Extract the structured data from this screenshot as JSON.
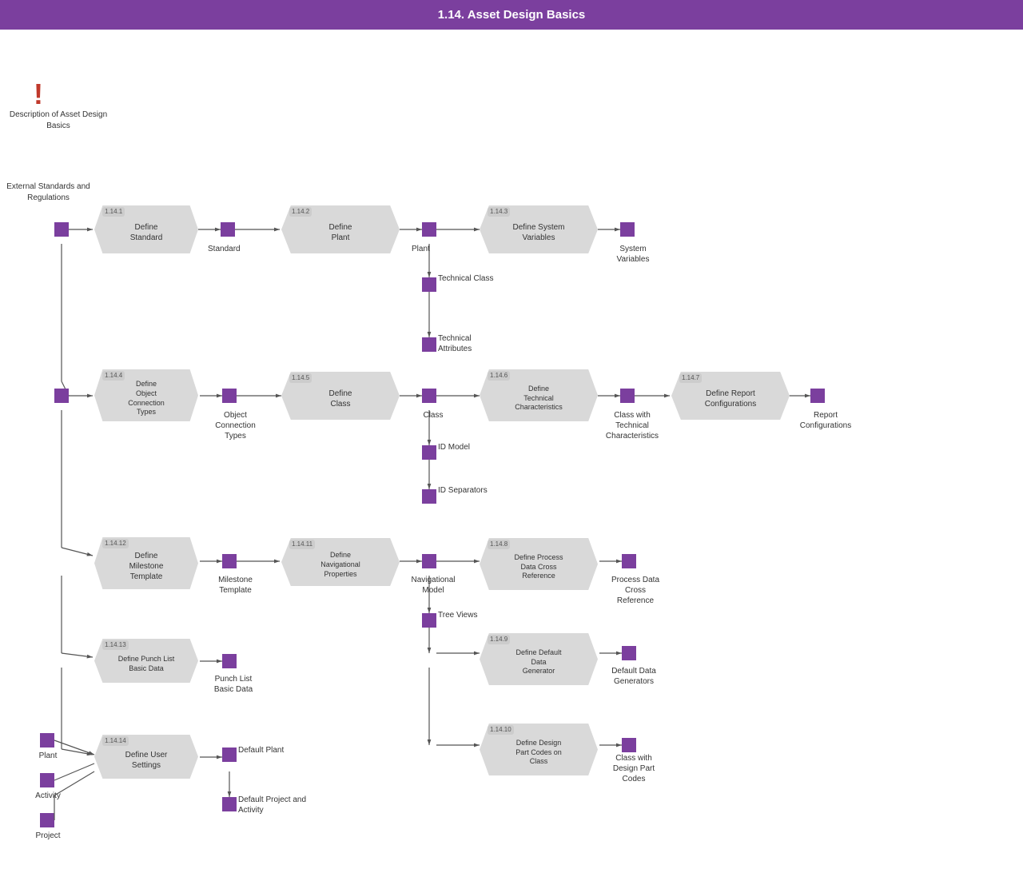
{
  "header": {
    "title": "1.14. Asset Design Basics"
  },
  "nodes": {
    "define_standard": {
      "id": "1.14.1",
      "label": "Define\nStandard"
    },
    "define_plant": {
      "id": "1.14.2",
      "label": "Define\nPlant"
    },
    "define_system_variables": {
      "id": "1.14.3",
      "label": "Define System\nVariables"
    },
    "define_object_connection": {
      "id": "1.14.4",
      "label": "Define\nObject\nConnection\nTypes"
    },
    "define_class": {
      "id": "1.14.5",
      "label": "Define\nClass"
    },
    "define_technical_chars": {
      "id": "1.14.6",
      "label": "Define\nTechnical\nCharacteristics"
    },
    "define_report_config": {
      "id": "1.14.7",
      "label": "Define Report\nConfigurations"
    },
    "define_process_data": {
      "id": "1.14.8",
      "label": "Define Process\nData Cross\nReference"
    },
    "define_default_data": {
      "id": "1.14.9",
      "label": "Define Default\nData\nGenerator"
    },
    "define_design_part": {
      "id": "1.14.10",
      "label": "Define Design\nPart Codes on\nClass"
    },
    "define_nav_properties": {
      "id": "1.14.11",
      "label": "Define\nNavigational\nProperties"
    },
    "define_milestone": {
      "id": "1.14.12",
      "label": "Define\nMilestone\nTemplate"
    },
    "define_punch_list": {
      "id": "1.14.13",
      "label": "Define Punch List\nBasic Data"
    },
    "define_user_settings": {
      "id": "1.14.14",
      "label": "Define User\nSettings"
    }
  },
  "labels": {
    "description": "Description\nof Asset\nDesign\nBasics",
    "external_standards": "External\nStandards\nand\nRegulations",
    "standard": "Standard",
    "plant_top": "Plant",
    "system_variables": "System\nVariables",
    "technical_class": "Technical\nClass",
    "technical_attributes": "Technical\nAttributes",
    "object_connection_types": "Object\nConnection\nTypes",
    "class": "Class",
    "id_model": "ID Model",
    "id_separators": "ID Separators",
    "class_with_tech": "Class with\nTechnical\nCharacteristics",
    "report_configurations": "Report\nConfigurations",
    "navigational_model": "Navigational\nModel",
    "tree_views": "Tree Views",
    "milestone_template": "Milestone\nTemplate",
    "process_data_cross_ref": "Process\nData Cross\nReference",
    "default_data_generators": "Default\nData\nGenerators",
    "class_design_part": "Class\nwith\nDesign\nPart\nCodes",
    "punch_list_basic": "Punch\nList Basic\nData",
    "default_plant": "Default\nPlant",
    "default_project": "Default\nProject and\nActivity",
    "plant_bottom": "Plant",
    "activity": "Activity",
    "project": "Project"
  },
  "colors": {
    "header_bg": "#7b3f9e",
    "purple": "#7b3f9e",
    "process_bg": "#d9d9d9",
    "badge_bg": "#cccccc"
  }
}
